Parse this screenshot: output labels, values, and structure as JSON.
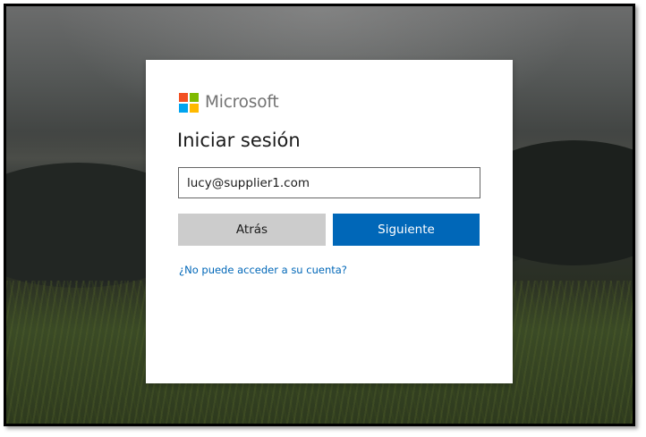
{
  "brand": {
    "name": "Microsoft",
    "logo_colors": [
      "#f25022",
      "#7fba00",
      "#00a4ef",
      "#ffb900"
    ]
  },
  "signin": {
    "title": "Iniciar sesión",
    "email_value": "lucy@supplier1.com",
    "back_label": "Atrás",
    "next_label": "Siguiente",
    "help_link": "¿No puede acceder a su cuenta?"
  },
  "colors": {
    "accent": "#0067b8",
    "secondary_button": "#cccccc",
    "text": "#1b1b1b",
    "logo_text": "#737373"
  }
}
